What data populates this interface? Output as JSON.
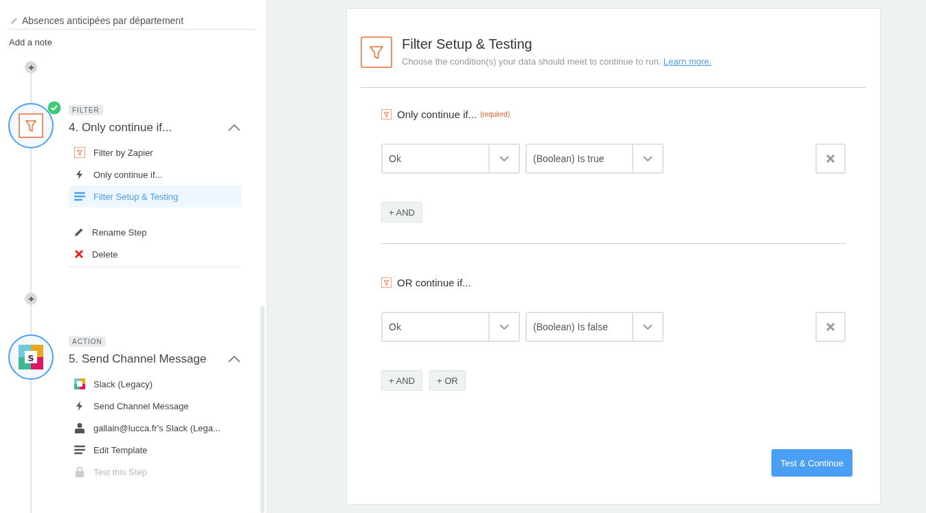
{
  "sidebar": {
    "zap_title": "Absences anticipées par département",
    "add_note": "Add a note",
    "steps": [
      {
        "kind": "filter",
        "tag": "FILTER",
        "title": "4. Only continue if...",
        "expanded": true,
        "completed": true,
        "items": [
          {
            "kind": "filter-app",
            "label": "Filter by Zapier",
            "selected": false,
            "disabled": false
          },
          {
            "kind": "bolt",
            "label": "Only continue if...",
            "selected": false,
            "disabled": false
          },
          {
            "kind": "lines",
            "label": "Filter Setup & Testing",
            "selected": true,
            "disabled": false
          }
        ],
        "actions": [
          {
            "kind": "rename",
            "label": "Rename Step"
          },
          {
            "kind": "delete",
            "label": "Delete"
          }
        ]
      },
      {
        "kind": "slack",
        "logo_letter": "s",
        "tag": "ACTION",
        "title": "5. Send Channel Message",
        "expanded": true,
        "completed": false,
        "items": [
          {
            "kind": "slack-app",
            "label": "Slack (Legacy)",
            "selected": false,
            "disabled": false
          },
          {
            "kind": "bolt",
            "label": "Send Channel Message",
            "selected": false,
            "disabled": false
          },
          {
            "kind": "person",
            "label": "gallain@lucca.fr's Slack (Lega...",
            "selected": false,
            "disabled": false
          },
          {
            "kind": "lines",
            "label": "Edit Template",
            "selected": false,
            "disabled": false
          },
          {
            "kind": "lock",
            "label": "Test this Step",
            "selected": false,
            "disabled": true
          }
        ]
      }
    ]
  },
  "panel": {
    "title": "Filter Setup & Testing",
    "description": "Choose the condition(s) your data should meet to continue to run.",
    "link": "Learn more.",
    "groups": [
      {
        "title": "Only continue if...",
        "required": "(required)",
        "conditions": [
          {
            "field": "Ok",
            "operator": "(Boolean) Is true"
          }
        ],
        "buttons": [
          "+ AND"
        ]
      },
      {
        "title": "OR continue if...",
        "conditions": [
          {
            "field": "Ok",
            "operator": "(Boolean) Is false"
          }
        ],
        "buttons": [
          "+ AND",
          "+ OR"
        ]
      }
    ],
    "submit": "Test & Continue"
  }
}
